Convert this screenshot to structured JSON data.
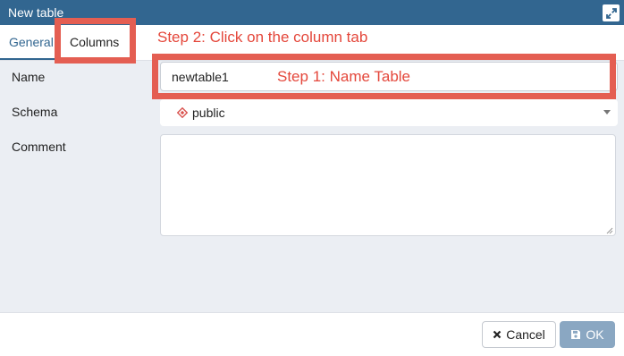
{
  "window": {
    "title": "New table",
    "maximize_icon": "expand-arrows-icon"
  },
  "tabs": [
    {
      "label": "General",
      "active": true
    },
    {
      "label": "Columns",
      "active": false
    }
  ],
  "annotations": {
    "step1": "Step 1: Name Table",
    "step2": "Step 2: Click on the column tab",
    "color": "#e45e52"
  },
  "form": {
    "name": {
      "label": "Name",
      "value": "newtable1"
    },
    "schema": {
      "label": "Schema",
      "value": "public",
      "icon": "schema-diamond-icon"
    },
    "comment": {
      "label": "Comment",
      "value": ""
    }
  },
  "footer": {
    "cancel": {
      "label": "Cancel",
      "icon": "close-icon"
    },
    "ok": {
      "label": "OK",
      "icon": "save-icon"
    }
  },
  "colors": {
    "titlebar": "#326690",
    "accent": "#326690",
    "ok_button": "#8aa7c2",
    "body_bg": "#ebeef3"
  }
}
